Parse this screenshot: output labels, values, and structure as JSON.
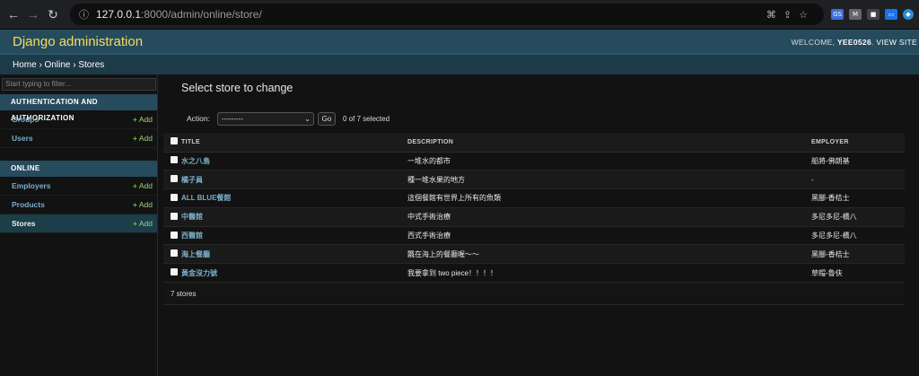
{
  "browser": {
    "url_host": "127.0.0.1",
    "url_path": ":8000/admin/online/store/"
  },
  "header": {
    "branding": "Django administration",
    "welcome": "WELCOME,",
    "username": "YEE0526",
    "view_site": "VIEW SITE"
  },
  "breadcrumbs": "Home › Online › Stores",
  "sidebar": {
    "filter_placeholder": "Start typing to filter...",
    "modules": [
      {
        "caption": "AUTHENTICATION AND AUTHORIZATION",
        "items": [
          {
            "label": "Groups",
            "add": "Add"
          },
          {
            "label": "Users",
            "add": "Add"
          }
        ]
      },
      {
        "caption": "ONLINE",
        "items": [
          {
            "label": "Employers",
            "add": "Add"
          },
          {
            "label": "Products",
            "add": "Add"
          },
          {
            "label": "Stores",
            "add": "Add"
          }
        ]
      }
    ]
  },
  "content": {
    "title": "Select store to change",
    "action_label": "Action:",
    "action_selected": "---------",
    "go_label": "Go",
    "counter": "0 of 7 selected",
    "columns": [
      "TITLE",
      "DESCRIPTION",
      "EMPLOYER"
    ],
    "rows": [
      {
        "title": "水之八島",
        "description": "一堆水的都市",
        "employer": "船將-佛朗基"
      },
      {
        "title": "橘子員",
        "description": "種一堆水果的地方",
        "employer": "-"
      },
      {
        "title": "ALL BLUE餐館",
        "description": "這個餐館有世界上所有的魚類",
        "employer": "黑腳-香桔士"
      },
      {
        "title": "中醫館",
        "description": "中式手術治療",
        "employer": "多尼多尼-橋八"
      },
      {
        "title": "西醫館",
        "description": "西式手術治療",
        "employer": "多尼多尼-橋八"
      },
      {
        "title": "海上餐廳",
        "description": "飄在海上的餐廳喔～～",
        "employer": "黑腳-香桔士"
      },
      {
        "title": "黃金沒力號",
        "description": "我要拿到 two piece！！！！",
        "employer": "草帽-魯伕"
      }
    ],
    "paginator": "7 stores"
  }
}
